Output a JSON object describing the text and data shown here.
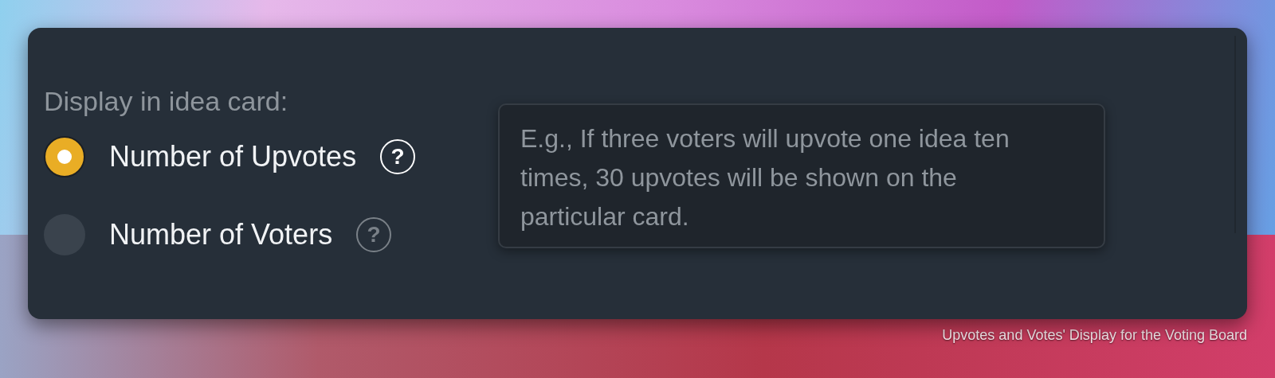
{
  "panel": {
    "heading": "Display in idea card:",
    "options": [
      {
        "label": "Number of Upvotes",
        "selected": true,
        "help_hovered": true
      },
      {
        "label": "Number of Voters",
        "selected": false,
        "help_hovered": false
      }
    ],
    "help_icon": "?",
    "tooltip": {
      "text": "E.g., If three voters will upvote one idea ten times, 30 upvotes will be shown on the particular card."
    }
  },
  "caption": "Upvotes and Votes' Display for the Voting Board"
}
